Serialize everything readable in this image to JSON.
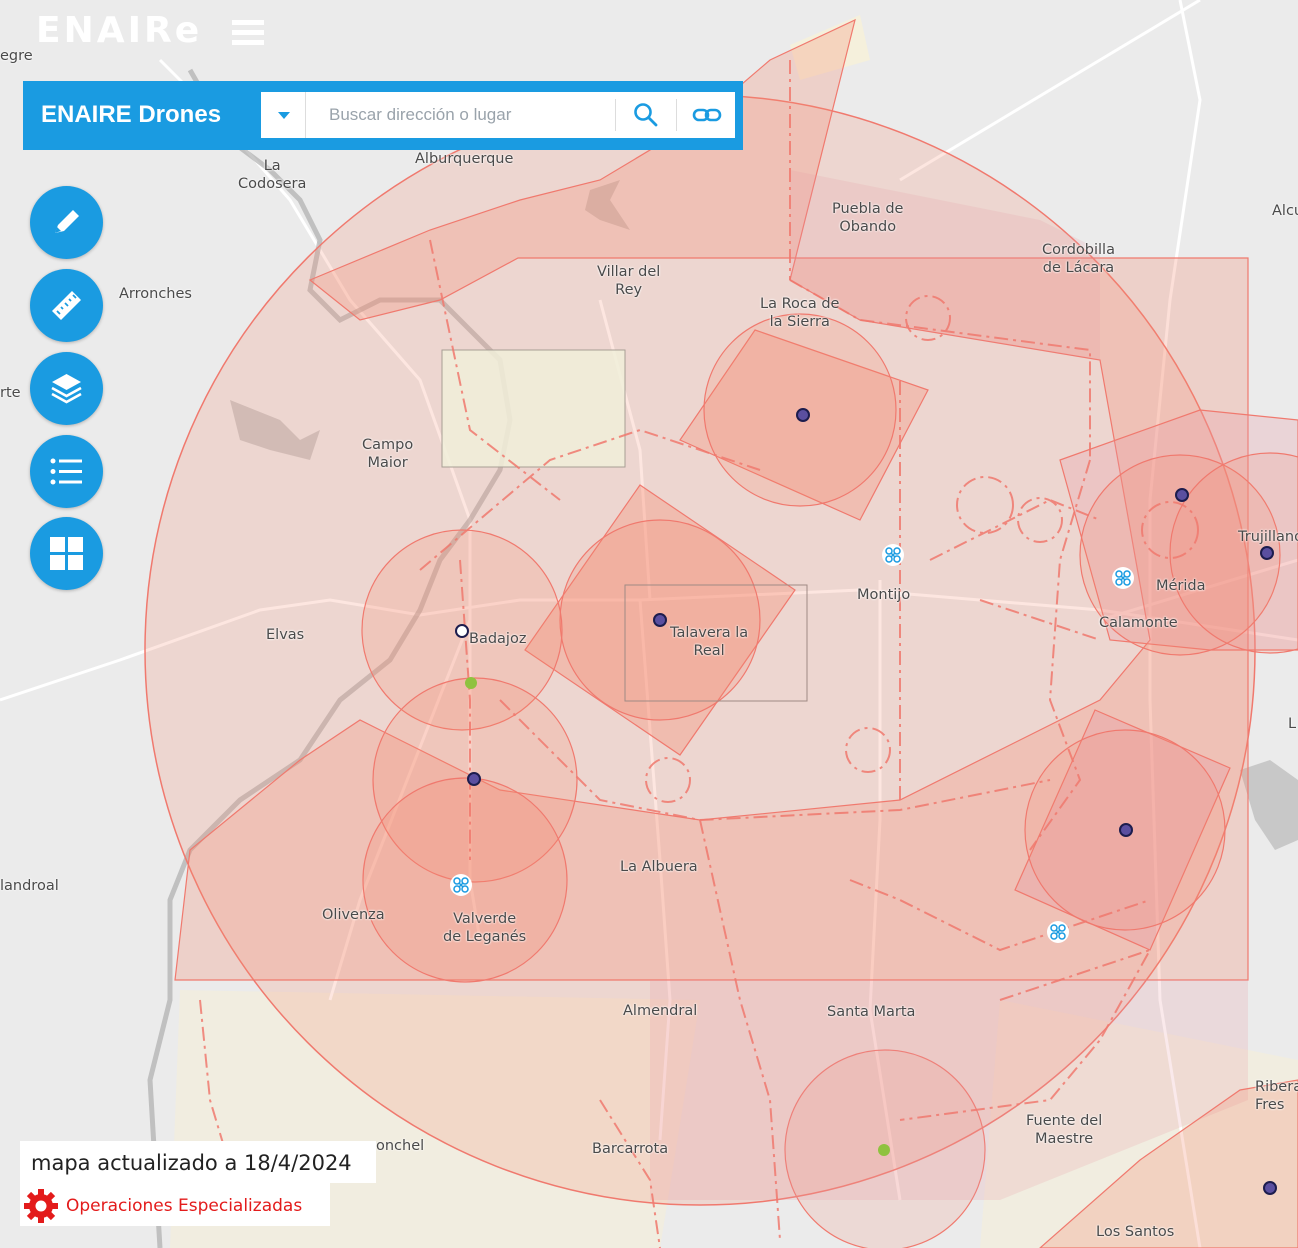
{
  "brand": {
    "logo_text": "ENAIRe"
  },
  "toolbar": {
    "title": "ENAIRE Drones",
    "search_placeholder": "Buscar dirección o lugar",
    "search_value": ""
  },
  "tools": [
    {
      "name": "draw-tool-button",
      "icon": "pencil-icon"
    },
    {
      "name": "measure-tool-button",
      "icon": "ruler-icon"
    },
    {
      "name": "layers-button",
      "icon": "layers-icon"
    },
    {
      "name": "legend-button",
      "icon": "list-icon"
    },
    {
      "name": "basemap-button",
      "icon": "grid-icon"
    }
  ],
  "places": {
    "egre": "egre",
    "la_codosera": "La\nCodosera",
    "alburquerque": "Alburquerque",
    "arronches": "Arronches",
    "rte": "rte",
    "villar_del_rey": "Villar del\nRey",
    "puebla_de_obando": "Puebla de\nObando",
    "alcu": "Alcu",
    "cordobilla": "Cordobilla\nde Lácara",
    "la_roca": "La Roca de\nla Sierra",
    "campo_maior": "Campo\nMaior",
    "elvas": "Elvas",
    "badajoz": "Badajoz",
    "talavera": "Talavera la\nReal",
    "montijo": "Montijo",
    "trujillano": "Trujillano",
    "merida": "Mérida",
    "calamonte": "Calamonte",
    "l": "L",
    "landroal": "landroal",
    "la_albuera": "La Albuera",
    "olivenza": "Olivenza",
    "valverde": "Valverde\nde Leganés",
    "almendral": "Almendral",
    "santa_marta": "Santa Marta",
    "onchel": "onchel",
    "barcarrota": "Barcarrota",
    "fuente_del_maestre": "Fuente del\nMaestre",
    "ribera": "Ribera\nFres",
    "los_santos": "Los Santos"
  },
  "info": {
    "updated_text": "mapa actualizado a  18/4/2024"
  },
  "legend": {
    "ops_label": "Operaciones Especializadas"
  },
  "colors": {
    "accent": "#1a9be1",
    "zone_fill": "#f58b74",
    "zone_stroke": "#f0796e",
    "alert_red": "#e31b1b"
  }
}
